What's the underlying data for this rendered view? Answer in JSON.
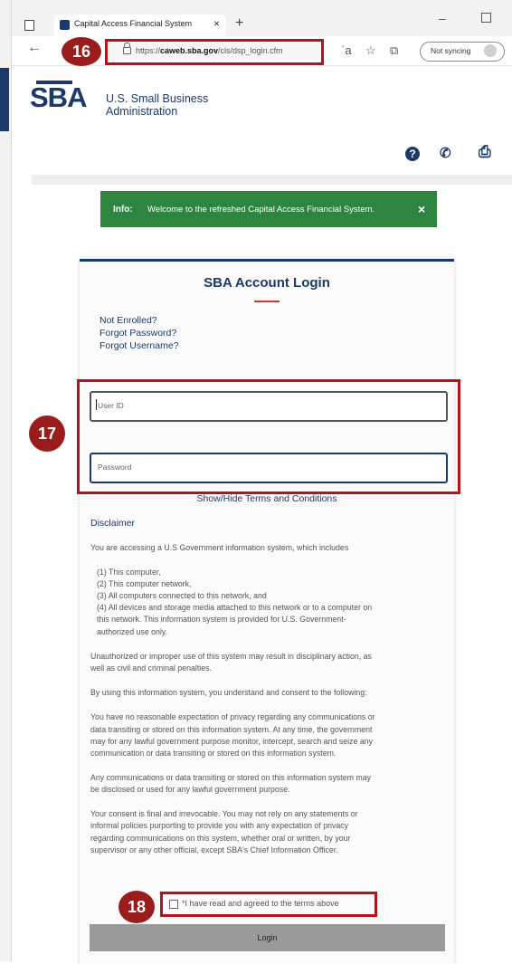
{
  "browser": {
    "tab_title": "Capital Access Financial System",
    "tab_close": "×",
    "new_tab": "+",
    "url_prefix": "https://",
    "url_domain": "caweb.sba.gov",
    "url_path": "/cls/dsp_login.cfm",
    "sync_label": "Not syncing"
  },
  "header": {
    "logo_text": "SBA",
    "org_line1": "U.S. Small Business",
    "org_line2": "Administration"
  },
  "alert": {
    "label": "Info:",
    "message": "Welcome to the refreshed Capital Access Financial System.",
    "close": "×"
  },
  "login": {
    "title": "SBA Account Login",
    "links": [
      "Not Enrolled?",
      "Forgot Password?",
      "Forgot Username?"
    ],
    "userid_placeholder": "User ID",
    "password_placeholder": "Password",
    "show_hide": "Show/Hide Terms and Conditions",
    "disclaimer_heading": "Disclaimer",
    "disclaimer_lines": [
      "You are accessing a U.S Government information system, which includes",
      "(1) This computer,",
      "(2) This computer network,",
      "(3) All computers connected to this network, and",
      "(4) All devices and storage media attached to this network or to a computer on",
      "this network. This information system is provided for U.S. Government-",
      "authorized use only.",
      "Unauthorized or improper use of this system may result in disciplinary action, as",
      "well as civil and criminal penalties.",
      "By using this information system, you understand and consent to the following:",
      "You have no reasonable expectation of privacy regarding any communications or",
      "data transiting or stored on this information system. At any time, the government",
      "may for any lawful government purpose monitor, intercept, search and seize any",
      "communication or data transiting or stored on this information system.",
      "Any communications or data transiting or stored on this information system may",
      "be disclosed or used for any lawful government purpose.",
      "Your consent is final and irrevocable. You may not rely on any statements or",
      "informal policies purporting to provide you with any expectation of privacy",
      "regarding communications on this system, whether oral or written, by your",
      "supervisor or any other official, except SBA's Chief Information Officer."
    ],
    "agree_label": "*I have read and agreed to the terms above",
    "login_button": "Login"
  },
  "callouts": [
    "16",
    "17",
    "18"
  ],
  "colors": {
    "brand_navy": "#1b3a6b",
    "alert_green": "#2e8540",
    "callout_red": "#9b1c1c",
    "highlight_red": "#b0141c"
  }
}
